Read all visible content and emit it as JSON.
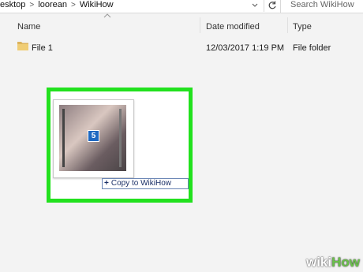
{
  "address_bar": {
    "segments": [
      "esktop",
      "loorean",
      "WikiHow"
    ],
    "separator": ">"
  },
  "search": {
    "placeholder": "Search WikiHow"
  },
  "columns": {
    "name": "Name",
    "date_modified": "Date modified",
    "type": "Type"
  },
  "files": [
    {
      "name": "File 1",
      "date_modified": "12/03/2017 1:19 PM",
      "type": "File folder"
    }
  ],
  "drag": {
    "item_count": "5",
    "tooltip_label": "Copy to WikiHow",
    "tooltip_prefix": "+",
    "highlight_color": "#22e11e",
    "badge_color": "#1e68c1"
  },
  "watermark": {
    "wiki": "wiki",
    "how": "How"
  }
}
